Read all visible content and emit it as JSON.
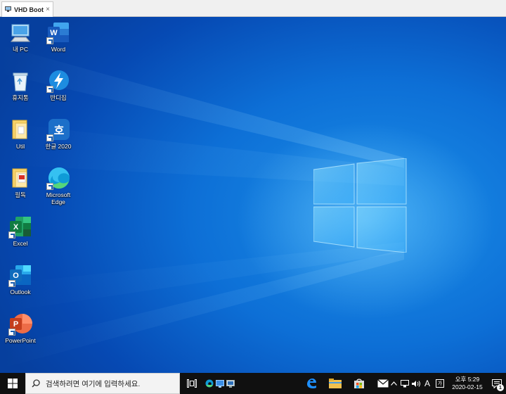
{
  "vm": {
    "tab_title": "VHD Boot",
    "close_glyph": "×"
  },
  "desktop_icons": [
    {
      "label": "내 PC",
      "icon": "this-pc-icon"
    },
    {
      "label": "Word",
      "icon": "word-icon"
    },
    {
      "label": "휴지통",
      "icon": "recycle-bin-icon"
    },
    {
      "label": "반디집",
      "icon": "bandizip-icon"
    },
    {
      "label": "Util",
      "icon": "folder-icon"
    },
    {
      "label": "한글 2020",
      "icon": "hangul-icon"
    },
    {
      "label": "필독",
      "icon": "folder-pdf-icon"
    },
    {
      "label": "Microsoft Edge",
      "icon": "edge-icon"
    },
    {
      "label": "Excel",
      "icon": "excel-icon"
    },
    {
      "label": "Outlook",
      "icon": "outlook-icon"
    },
    {
      "label": "PowerPoint",
      "icon": "powerpoint-icon"
    }
  ],
  "icon_glyphs": {
    "word": "W",
    "hangul": "호",
    "excel": "X",
    "outlook": "O",
    "powerpoint": "P",
    "pdf": "PDF"
  },
  "taskbar": {
    "search_placeholder": "검색하려면 여기에 입력하세요.",
    "ime_label": "A",
    "ime_mode": "가"
  },
  "clock": {
    "time": "오후 5:29",
    "date": "2020-02-15"
  },
  "notifications": {
    "count": "1"
  },
  "colors": {
    "word": "#2b579a",
    "excel": "#217346",
    "outlook": "#0f6cbd",
    "powerpoint": "#d24726",
    "bandizip": "#1d8ce0",
    "hangul": "#1c6fc9",
    "edge": "#0f9bd7",
    "taskbar": "#101010"
  }
}
